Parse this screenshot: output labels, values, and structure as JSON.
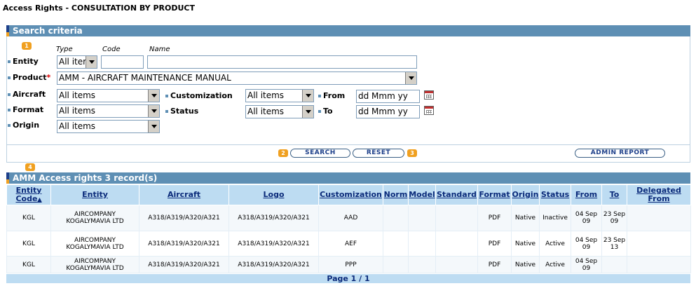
{
  "page": {
    "title": "Access Rights - CONSULTATION BY PRODUCT"
  },
  "criteria": {
    "header": "Search criteria",
    "badges": {
      "b1": "1",
      "b2": "2",
      "b3": "3",
      "b4": "4"
    },
    "col_headers": {
      "type": "Type",
      "code": "Code",
      "name": "Name"
    },
    "entity": {
      "label": "Entity",
      "type_value": "All iter",
      "code_value": "",
      "name_value": ""
    },
    "product": {
      "label": "Product",
      "required_mark": "*",
      "value": "AMM - AIRCRAFT MAINTENANCE MANUAL"
    },
    "aircraft": {
      "label": "Aircraft",
      "value": "All items"
    },
    "format": {
      "label": "Format",
      "value": "All items"
    },
    "origin": {
      "label": "Origin",
      "value": "All items"
    },
    "customization": {
      "label": "Customization",
      "value": "All items"
    },
    "status": {
      "label": "Status",
      "value": "All items"
    },
    "from": {
      "label": "From",
      "value": "dd Mmm yy"
    },
    "to": {
      "label": "To",
      "value": "dd Mmm yy"
    },
    "buttons": {
      "search": "SEARCH",
      "reset": "RESET",
      "admin_report": "ADMIN REPORT"
    }
  },
  "results": {
    "header": "AMM  Access rights  3 record(s)",
    "columns": {
      "entity_code": "Entity Code",
      "entity": "Entity",
      "aircraft": "Aircraft",
      "logo": "Logo",
      "customization": "Customization",
      "norm": "Norm",
      "model": "Model",
      "standard": "Standard",
      "format": "Format",
      "origin": "Origin",
      "status": "Status",
      "from": "From",
      "to": "To",
      "delegated_from": "Delegated From"
    },
    "sort_glyph": "▲",
    "rows": [
      {
        "entity_code": "KGL",
        "entity": "AIRCOMPANY KOGALYMAVIA LTD",
        "aircraft": "A318/A319/A320/A321",
        "logo": "A318/A319/A320/A321",
        "customization": "AAD",
        "norm": "",
        "model": "",
        "standard": "",
        "format": "PDF",
        "origin": "Native",
        "status": "Inactive",
        "from": "04 Sep 09",
        "to": "23 Sep 09",
        "delegated_from": ""
      },
      {
        "entity_code": "KGL",
        "entity": "AIRCOMPANY KOGALYMAVIA LTD",
        "aircraft": "A318/A319/A320/A321",
        "logo": "A318/A319/A320/A321",
        "customization": "AEF",
        "norm": "",
        "model": "",
        "standard": "",
        "format": "PDF",
        "origin": "Native",
        "status": "Active",
        "from": "04 Sep 09",
        "to": "23 Sep 13",
        "delegated_from": ""
      },
      {
        "entity_code": "KGL",
        "entity": "AIRCOMPANY KOGALYMAVIA LTD",
        "aircraft": "A318/A319/A320/A321",
        "logo": "A318/A319/A320/A321",
        "customization": "PPP",
        "norm": "",
        "model": "",
        "standard": "",
        "format": "PDF",
        "origin": "Native",
        "status": "Active",
        "from": "04 Sep 09",
        "to": "",
        "delegated_from": ""
      }
    ],
    "pager": "Page 1 / 1"
  }
}
